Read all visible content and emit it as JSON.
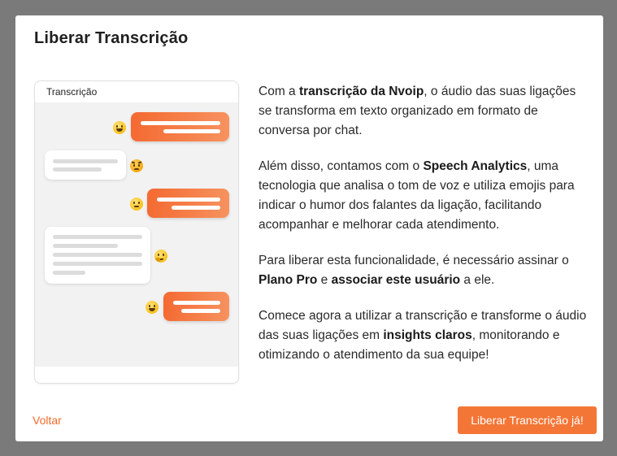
{
  "modal": {
    "title": "Liberar Transcrição",
    "back_label": "Voltar",
    "cta_label": "Liberar Transcrição já!"
  },
  "preview": {
    "title": "Transcrição",
    "messages": [
      {
        "side": "out",
        "emoji": "grinning-face-icon"
      },
      {
        "side": "in",
        "emoji": "angry-face-icon"
      },
      {
        "side": "out",
        "emoji": "neutral-face-icon"
      },
      {
        "side": "in",
        "emoji": "thinking-face-icon"
      },
      {
        "side": "out",
        "emoji": "grinning-face-icon"
      }
    ]
  },
  "description": {
    "p1": {
      "a": "Com a ",
      "b": "transcrição da Nvoip",
      "c": ", o áudio das suas ligações se transforma em texto organizado em formato de conversa por chat."
    },
    "p2": {
      "a": "Além disso, contamos com o ",
      "b": "Speech Analytics",
      "c": ", uma tecnologia que analisa o tom de voz e utiliza emojis para indicar o humor dos falantes da ligação, facilitando acompanhar e melhorar cada atendimento."
    },
    "p3": {
      "a": "Para liberar esta funcionalidade, é necessário assinar o ",
      "b": "Plano Pro",
      "c": " e ",
      "d": "associar este usuário",
      "e": " a ele."
    },
    "p4": {
      "a": "Comece agora a utilizar a transcrição e transforme o áudio das suas ligações em ",
      "b": "insights claros",
      "c": ", monitorando e otimizando o atendimento da sua equipe!"
    }
  },
  "colors": {
    "accent": "#f47636",
    "overlay": "#7a7a7a"
  }
}
